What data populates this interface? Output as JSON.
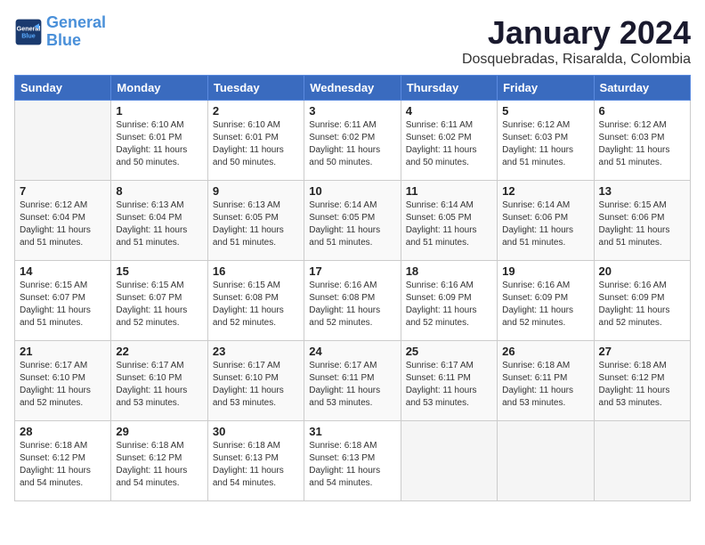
{
  "header": {
    "logo_line1": "General",
    "logo_line2": "Blue",
    "month": "January 2024",
    "location": "Dosquebradas, Risaralda, Colombia"
  },
  "weekdays": [
    "Sunday",
    "Monday",
    "Tuesday",
    "Wednesday",
    "Thursday",
    "Friday",
    "Saturday"
  ],
  "weeks": [
    [
      {
        "day": "",
        "info": ""
      },
      {
        "day": "1",
        "info": "Sunrise: 6:10 AM\nSunset: 6:01 PM\nDaylight: 11 hours\nand 50 minutes."
      },
      {
        "day": "2",
        "info": "Sunrise: 6:10 AM\nSunset: 6:01 PM\nDaylight: 11 hours\nand 50 minutes."
      },
      {
        "day": "3",
        "info": "Sunrise: 6:11 AM\nSunset: 6:02 PM\nDaylight: 11 hours\nand 50 minutes."
      },
      {
        "day": "4",
        "info": "Sunrise: 6:11 AM\nSunset: 6:02 PM\nDaylight: 11 hours\nand 50 minutes."
      },
      {
        "day": "5",
        "info": "Sunrise: 6:12 AM\nSunset: 6:03 PM\nDaylight: 11 hours\nand 51 minutes."
      },
      {
        "day": "6",
        "info": "Sunrise: 6:12 AM\nSunset: 6:03 PM\nDaylight: 11 hours\nand 51 minutes."
      }
    ],
    [
      {
        "day": "7",
        "info": "Sunrise: 6:12 AM\nSunset: 6:04 PM\nDaylight: 11 hours\nand 51 minutes."
      },
      {
        "day": "8",
        "info": "Sunrise: 6:13 AM\nSunset: 6:04 PM\nDaylight: 11 hours\nand 51 minutes."
      },
      {
        "day": "9",
        "info": "Sunrise: 6:13 AM\nSunset: 6:05 PM\nDaylight: 11 hours\nand 51 minutes."
      },
      {
        "day": "10",
        "info": "Sunrise: 6:14 AM\nSunset: 6:05 PM\nDaylight: 11 hours\nand 51 minutes."
      },
      {
        "day": "11",
        "info": "Sunrise: 6:14 AM\nSunset: 6:05 PM\nDaylight: 11 hours\nand 51 minutes."
      },
      {
        "day": "12",
        "info": "Sunrise: 6:14 AM\nSunset: 6:06 PM\nDaylight: 11 hours\nand 51 minutes."
      },
      {
        "day": "13",
        "info": "Sunrise: 6:15 AM\nSunset: 6:06 PM\nDaylight: 11 hours\nand 51 minutes."
      }
    ],
    [
      {
        "day": "14",
        "info": "Sunrise: 6:15 AM\nSunset: 6:07 PM\nDaylight: 11 hours\nand 51 minutes."
      },
      {
        "day": "15",
        "info": "Sunrise: 6:15 AM\nSunset: 6:07 PM\nDaylight: 11 hours\nand 52 minutes."
      },
      {
        "day": "16",
        "info": "Sunrise: 6:15 AM\nSunset: 6:08 PM\nDaylight: 11 hours\nand 52 minutes."
      },
      {
        "day": "17",
        "info": "Sunrise: 6:16 AM\nSunset: 6:08 PM\nDaylight: 11 hours\nand 52 minutes."
      },
      {
        "day": "18",
        "info": "Sunrise: 6:16 AM\nSunset: 6:09 PM\nDaylight: 11 hours\nand 52 minutes."
      },
      {
        "day": "19",
        "info": "Sunrise: 6:16 AM\nSunset: 6:09 PM\nDaylight: 11 hours\nand 52 minutes."
      },
      {
        "day": "20",
        "info": "Sunrise: 6:16 AM\nSunset: 6:09 PM\nDaylight: 11 hours\nand 52 minutes."
      }
    ],
    [
      {
        "day": "21",
        "info": "Sunrise: 6:17 AM\nSunset: 6:10 PM\nDaylight: 11 hours\nand 52 minutes."
      },
      {
        "day": "22",
        "info": "Sunrise: 6:17 AM\nSunset: 6:10 PM\nDaylight: 11 hours\nand 53 minutes."
      },
      {
        "day": "23",
        "info": "Sunrise: 6:17 AM\nSunset: 6:10 PM\nDaylight: 11 hours\nand 53 minutes."
      },
      {
        "day": "24",
        "info": "Sunrise: 6:17 AM\nSunset: 6:11 PM\nDaylight: 11 hours\nand 53 minutes."
      },
      {
        "day": "25",
        "info": "Sunrise: 6:17 AM\nSunset: 6:11 PM\nDaylight: 11 hours\nand 53 minutes."
      },
      {
        "day": "26",
        "info": "Sunrise: 6:18 AM\nSunset: 6:11 PM\nDaylight: 11 hours\nand 53 minutes."
      },
      {
        "day": "27",
        "info": "Sunrise: 6:18 AM\nSunset: 6:12 PM\nDaylight: 11 hours\nand 53 minutes."
      }
    ],
    [
      {
        "day": "28",
        "info": "Sunrise: 6:18 AM\nSunset: 6:12 PM\nDaylight: 11 hours\nand 54 minutes."
      },
      {
        "day": "29",
        "info": "Sunrise: 6:18 AM\nSunset: 6:12 PM\nDaylight: 11 hours\nand 54 minutes."
      },
      {
        "day": "30",
        "info": "Sunrise: 6:18 AM\nSunset: 6:13 PM\nDaylight: 11 hours\nand 54 minutes."
      },
      {
        "day": "31",
        "info": "Sunrise: 6:18 AM\nSunset: 6:13 PM\nDaylight: 11 hours\nand 54 minutes."
      },
      {
        "day": "",
        "info": ""
      },
      {
        "day": "",
        "info": ""
      },
      {
        "day": "",
        "info": ""
      }
    ]
  ]
}
